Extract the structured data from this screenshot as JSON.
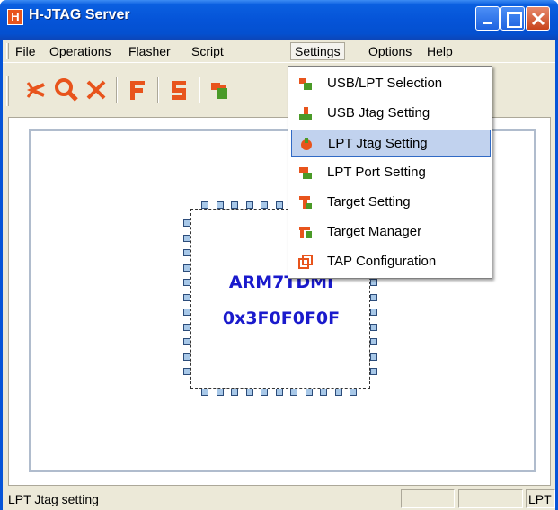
{
  "window": {
    "title": "H-JTAG Server",
    "icon_letter": "H"
  },
  "menubar": {
    "items": [
      "File",
      "Operations",
      "Flasher",
      "Script",
      "Settings",
      "Options",
      "Help"
    ]
  },
  "settings_menu": {
    "items": [
      {
        "label": "USB/LPT Selection",
        "icon": "usb-lpt-selection-icon"
      },
      {
        "label": "USB Jtag Setting",
        "icon": "usb-jtag-icon"
      },
      {
        "label": "LPT Jtag Setting",
        "icon": "lpt-jtag-icon",
        "highlighted": true
      },
      {
        "label": "LPT Port Setting",
        "icon": "lpt-port-icon"
      },
      {
        "label": "Target Setting",
        "icon": "target-setting-icon"
      },
      {
        "label": "Target Manager",
        "icon": "target-manager-icon"
      },
      {
        "label": "TAP Configuration",
        "icon": "tap-configuration-icon"
      }
    ]
  },
  "chip": {
    "name": "ARM7TDMI",
    "id": "0x3F0F0F0F"
  },
  "statusbar": {
    "message": "LPT Jtag setting",
    "pane3": "LPT"
  },
  "colors": {
    "titlebar": "#0554d8",
    "chip_text": "#1a1acc",
    "highlight": "#c1d2ee"
  }
}
